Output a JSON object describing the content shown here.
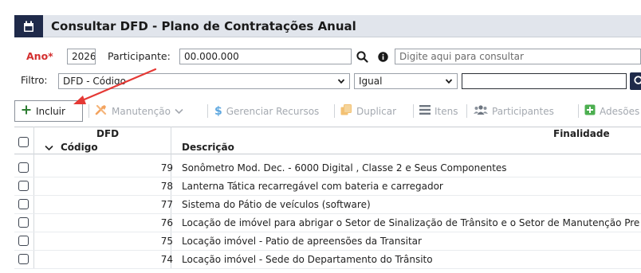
{
  "title": "Consultar DFD - Plano de Contratações Anual",
  "filters": {
    "ano_label": "Ano*",
    "ano_value": "2026",
    "participante_label": "Participante:",
    "participante_value": "00.000.000",
    "consulta_placeholder": "Digite aqui para consultar",
    "filtro_label": "Filtro:",
    "filtro_value": "DFD - Código",
    "operador_value": "Igual",
    "valor_value": ""
  },
  "toolbar": {
    "incluir": "Incluir",
    "manutencao": "Manutenção",
    "gerenciar_recursos": "Gerenciar Recursos",
    "duplicar": "Duplicar",
    "itens": "Itens",
    "participantes": "Participantes",
    "adesoes": "Adesões"
  },
  "grid": {
    "group_header": "DFD",
    "finalidade_header": "Finalidade",
    "codigo_header": "Código",
    "descricao_header": "Descrição",
    "rows": [
      {
        "codigo": "79",
        "descricao": "Sonômetro Mod. Dec. - 6000 Digital , Classe 2 e Seus Componentes"
      },
      {
        "codigo": "78",
        "descricao": "Lanterna Tática recarregável com bateria e carregador"
      },
      {
        "codigo": "77",
        "descricao": "Sistema do Pátio de veículos (software)"
      },
      {
        "codigo": "76",
        "descricao": "Locação de imóvel para abrigar o Setor de Sinalização de Trânsito e o Setor de Manutenção Pre"
      },
      {
        "codigo": "75",
        "descricao": "Locação imóvel - Patio de apreensões da Transitar"
      },
      {
        "codigo": "74",
        "descricao": "Locação imóvel - Sede do Departamento do Trânsito"
      }
    ]
  },
  "colors": {
    "header_bg": "#e1e5ec",
    "icon_dark": "#1f2a4a",
    "required_red": "#d32f2f",
    "annotation_arrow": "#e53935",
    "incluir_green": "#2e7d32",
    "manutencao_orange": "#f3a35f",
    "gerenciar_blue": "#5fa8e0",
    "adesoes_green": "#4caf50"
  }
}
